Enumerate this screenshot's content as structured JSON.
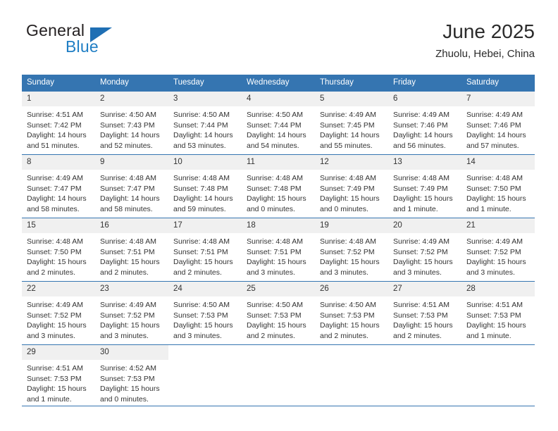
{
  "brand": {
    "name_top": "General",
    "name_bottom": "Blue",
    "triangle_icon": "triangle-icon",
    "accent_color": "#1f7ec4"
  },
  "header": {
    "title": "June 2025",
    "location": "Zhuolu, Hebei, China"
  },
  "theme": {
    "header_bg": "#3575b1",
    "daynum_bg": "#f0f0f0",
    "row_divider": "#3575b1",
    "text": "#333333"
  },
  "calendar": {
    "weekday_headers": [
      "Sunday",
      "Monday",
      "Tuesday",
      "Wednesday",
      "Thursday",
      "Friday",
      "Saturday"
    ],
    "weeks": [
      [
        {
          "day": "1",
          "sunrise": "Sunrise: 4:51 AM",
          "sunset": "Sunset: 7:42 PM",
          "daylight_line1": "Daylight: 14 hours",
          "daylight_line2": "and 51 minutes."
        },
        {
          "day": "2",
          "sunrise": "Sunrise: 4:50 AM",
          "sunset": "Sunset: 7:43 PM",
          "daylight_line1": "Daylight: 14 hours",
          "daylight_line2": "and 52 minutes."
        },
        {
          "day": "3",
          "sunrise": "Sunrise: 4:50 AM",
          "sunset": "Sunset: 7:44 PM",
          "daylight_line1": "Daylight: 14 hours",
          "daylight_line2": "and 53 minutes."
        },
        {
          "day": "4",
          "sunrise": "Sunrise: 4:50 AM",
          "sunset": "Sunset: 7:44 PM",
          "daylight_line1": "Daylight: 14 hours",
          "daylight_line2": "and 54 minutes."
        },
        {
          "day": "5",
          "sunrise": "Sunrise: 4:49 AM",
          "sunset": "Sunset: 7:45 PM",
          "daylight_line1": "Daylight: 14 hours",
          "daylight_line2": "and 55 minutes."
        },
        {
          "day": "6",
          "sunrise": "Sunrise: 4:49 AM",
          "sunset": "Sunset: 7:46 PM",
          "daylight_line1": "Daylight: 14 hours",
          "daylight_line2": "and 56 minutes."
        },
        {
          "day": "7",
          "sunrise": "Sunrise: 4:49 AM",
          "sunset": "Sunset: 7:46 PM",
          "daylight_line1": "Daylight: 14 hours",
          "daylight_line2": "and 57 minutes."
        }
      ],
      [
        {
          "day": "8",
          "sunrise": "Sunrise: 4:49 AM",
          "sunset": "Sunset: 7:47 PM",
          "daylight_line1": "Daylight: 14 hours",
          "daylight_line2": "and 58 minutes."
        },
        {
          "day": "9",
          "sunrise": "Sunrise: 4:48 AM",
          "sunset": "Sunset: 7:47 PM",
          "daylight_line1": "Daylight: 14 hours",
          "daylight_line2": "and 58 minutes."
        },
        {
          "day": "10",
          "sunrise": "Sunrise: 4:48 AM",
          "sunset": "Sunset: 7:48 PM",
          "daylight_line1": "Daylight: 14 hours",
          "daylight_line2": "and 59 minutes."
        },
        {
          "day": "11",
          "sunrise": "Sunrise: 4:48 AM",
          "sunset": "Sunset: 7:48 PM",
          "daylight_line1": "Daylight: 15 hours",
          "daylight_line2": "and 0 minutes."
        },
        {
          "day": "12",
          "sunrise": "Sunrise: 4:48 AM",
          "sunset": "Sunset: 7:49 PM",
          "daylight_line1": "Daylight: 15 hours",
          "daylight_line2": "and 0 minutes."
        },
        {
          "day": "13",
          "sunrise": "Sunrise: 4:48 AM",
          "sunset": "Sunset: 7:49 PM",
          "daylight_line1": "Daylight: 15 hours",
          "daylight_line2": "and 1 minute."
        },
        {
          "day": "14",
          "sunrise": "Sunrise: 4:48 AM",
          "sunset": "Sunset: 7:50 PM",
          "daylight_line1": "Daylight: 15 hours",
          "daylight_line2": "and 1 minute."
        }
      ],
      [
        {
          "day": "15",
          "sunrise": "Sunrise: 4:48 AM",
          "sunset": "Sunset: 7:50 PM",
          "daylight_line1": "Daylight: 15 hours",
          "daylight_line2": "and 2 minutes."
        },
        {
          "day": "16",
          "sunrise": "Sunrise: 4:48 AM",
          "sunset": "Sunset: 7:51 PM",
          "daylight_line1": "Daylight: 15 hours",
          "daylight_line2": "and 2 minutes."
        },
        {
          "day": "17",
          "sunrise": "Sunrise: 4:48 AM",
          "sunset": "Sunset: 7:51 PM",
          "daylight_line1": "Daylight: 15 hours",
          "daylight_line2": "and 2 minutes."
        },
        {
          "day": "18",
          "sunrise": "Sunrise: 4:48 AM",
          "sunset": "Sunset: 7:51 PM",
          "daylight_line1": "Daylight: 15 hours",
          "daylight_line2": "and 3 minutes."
        },
        {
          "day": "19",
          "sunrise": "Sunrise: 4:48 AM",
          "sunset": "Sunset: 7:52 PM",
          "daylight_line1": "Daylight: 15 hours",
          "daylight_line2": "and 3 minutes."
        },
        {
          "day": "20",
          "sunrise": "Sunrise: 4:49 AM",
          "sunset": "Sunset: 7:52 PM",
          "daylight_line1": "Daylight: 15 hours",
          "daylight_line2": "and 3 minutes."
        },
        {
          "day": "21",
          "sunrise": "Sunrise: 4:49 AM",
          "sunset": "Sunset: 7:52 PM",
          "daylight_line1": "Daylight: 15 hours",
          "daylight_line2": "and 3 minutes."
        }
      ],
      [
        {
          "day": "22",
          "sunrise": "Sunrise: 4:49 AM",
          "sunset": "Sunset: 7:52 PM",
          "daylight_line1": "Daylight: 15 hours",
          "daylight_line2": "and 3 minutes."
        },
        {
          "day": "23",
          "sunrise": "Sunrise: 4:49 AM",
          "sunset": "Sunset: 7:52 PM",
          "daylight_line1": "Daylight: 15 hours",
          "daylight_line2": "and 3 minutes."
        },
        {
          "day": "24",
          "sunrise": "Sunrise: 4:50 AM",
          "sunset": "Sunset: 7:53 PM",
          "daylight_line1": "Daylight: 15 hours",
          "daylight_line2": "and 3 minutes."
        },
        {
          "day": "25",
          "sunrise": "Sunrise: 4:50 AM",
          "sunset": "Sunset: 7:53 PM",
          "daylight_line1": "Daylight: 15 hours",
          "daylight_line2": "and 2 minutes."
        },
        {
          "day": "26",
          "sunrise": "Sunrise: 4:50 AM",
          "sunset": "Sunset: 7:53 PM",
          "daylight_line1": "Daylight: 15 hours",
          "daylight_line2": "and 2 minutes."
        },
        {
          "day": "27",
          "sunrise": "Sunrise: 4:51 AM",
          "sunset": "Sunset: 7:53 PM",
          "daylight_line1": "Daylight: 15 hours",
          "daylight_line2": "and 2 minutes."
        },
        {
          "day": "28",
          "sunrise": "Sunrise: 4:51 AM",
          "sunset": "Sunset: 7:53 PM",
          "daylight_line1": "Daylight: 15 hours",
          "daylight_line2": "and 1 minute."
        }
      ],
      [
        {
          "day": "29",
          "sunrise": "Sunrise: 4:51 AM",
          "sunset": "Sunset: 7:53 PM",
          "daylight_line1": "Daylight: 15 hours",
          "daylight_line2": "and 1 minute."
        },
        {
          "day": "30",
          "sunrise": "Sunrise: 4:52 AM",
          "sunset": "Sunset: 7:53 PM",
          "daylight_line1": "Daylight: 15 hours",
          "daylight_line2": "and 0 minutes."
        },
        {
          "day": "",
          "sunrise": "",
          "sunset": "",
          "daylight_line1": "",
          "daylight_line2": ""
        },
        {
          "day": "",
          "sunrise": "",
          "sunset": "",
          "daylight_line1": "",
          "daylight_line2": ""
        },
        {
          "day": "",
          "sunrise": "",
          "sunset": "",
          "daylight_line1": "",
          "daylight_line2": ""
        },
        {
          "day": "",
          "sunrise": "",
          "sunset": "",
          "daylight_line1": "",
          "daylight_line2": ""
        },
        {
          "day": "",
          "sunrise": "",
          "sunset": "",
          "daylight_line1": "",
          "daylight_line2": ""
        }
      ]
    ]
  }
}
